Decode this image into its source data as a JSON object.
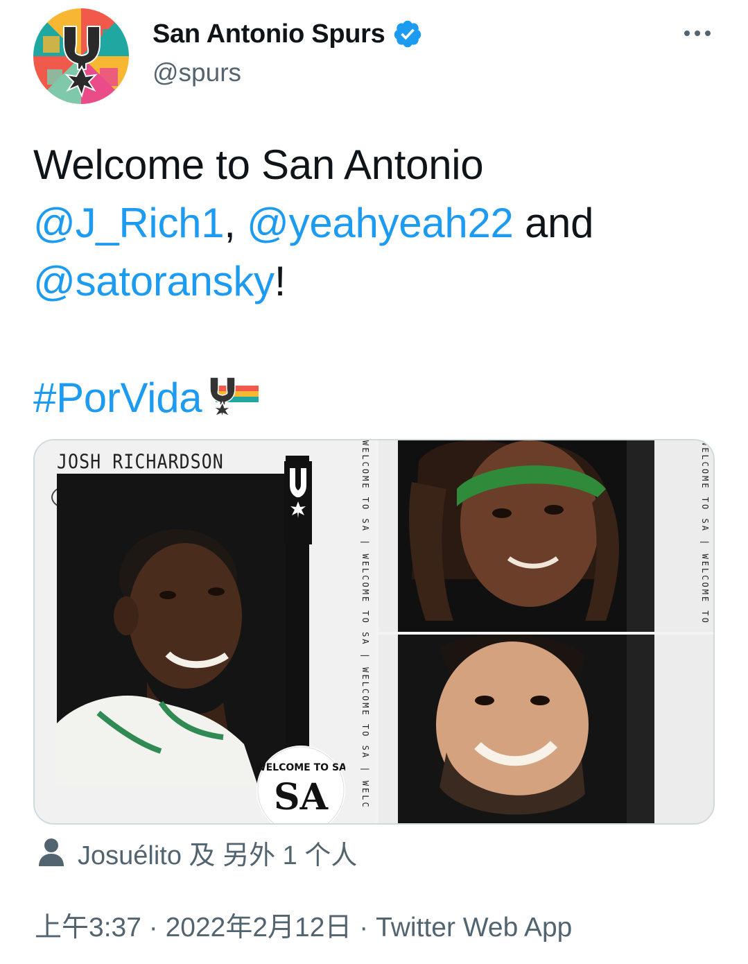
{
  "header": {
    "display_name": "San Antonio Spurs",
    "handle": "@spurs",
    "verified": true,
    "avatar_icon": "spurs-logo-icon",
    "more_icon": "more-horizontal-icon"
  },
  "tweet": {
    "line1": "Welcome to San Antonio",
    "mention1": "@J_Rich1",
    "sep1": ", ",
    "mention2": "@yeahyeah22",
    "and_text": " and",
    "mention3": "@satoransky",
    "exclaim": "!",
    "hashtag": "#PorVida",
    "hashtag_emoji": "spurs-hashflag-icon"
  },
  "media": {
    "left": {
      "player_name": "JOSH RICHARDSON",
      "position": "G"
    },
    "strip_text": "WELCOME TO SA | WELCOME TO SA | WELCOME TO SA | WELC",
    "badge_top": "WELCOME TO SA",
    "badge_mark": "SA"
  },
  "social_context": {
    "icon": "person-icon",
    "text": "Josuélito 及 另外 1 个人"
  },
  "meta": {
    "time": "上午3:37",
    "dot": " · ",
    "date": "2022年2月12日",
    "source": "Twitter Web App"
  },
  "colors": {
    "link": "#1d9bf0",
    "secondary_text": "#536471",
    "primary_text": "#0f1419",
    "verified": "#1d9bf0",
    "border": "#cfd9de"
  }
}
